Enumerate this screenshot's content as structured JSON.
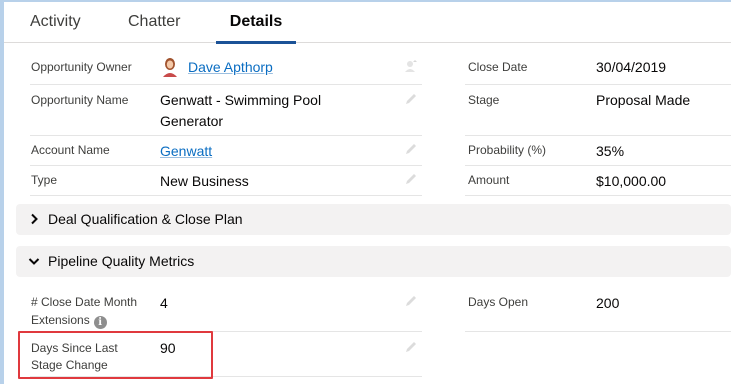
{
  "tabs": [
    {
      "label": "Activity"
    },
    {
      "label": "Chatter"
    },
    {
      "label": "Details"
    }
  ],
  "fields_left": [
    {
      "label": "Opportunity Owner",
      "value": "Dave Apthorp",
      "link": true
    },
    {
      "label": "Opportunity Name",
      "value_line1": "Genwatt - Swimming Pool",
      "value_line2": "Generator"
    },
    {
      "label": "Account Name",
      "value": "Genwatt",
      "link": true
    },
    {
      "label": "Type",
      "value": "New Business"
    }
  ],
  "fields_right": [
    {
      "label": "Close Date",
      "value": "30/04/2019"
    },
    {
      "label": "Stage",
      "value": "Proposal Made"
    },
    {
      "label": "Probability (%)",
      "value": "35%"
    },
    {
      "label": "Amount",
      "value": "$10,000.00"
    }
  ],
  "sections": [
    {
      "title": "Deal Qualification & Close Plan",
      "expanded": false
    },
    {
      "title": "Pipeline Quality Metrics",
      "expanded": true
    }
  ],
  "metrics": {
    "close_ext_label_line1": "# Close Date Month",
    "close_ext_label_line2": "Extensions",
    "close_ext_value": "4",
    "days_open_label": "Days Open",
    "days_open_value": "200",
    "days_since_label_line1": "Days Since Last",
    "days_since_label_line2": "Stage Change",
    "days_since_value": "90"
  },
  "colors": {
    "tab_active_underline": "#1b5297",
    "link": "#0a6dc2",
    "section_bg": "#f3f2f2",
    "highlight": "#e0393e"
  },
  "icons": {
    "info": "i"
  }
}
